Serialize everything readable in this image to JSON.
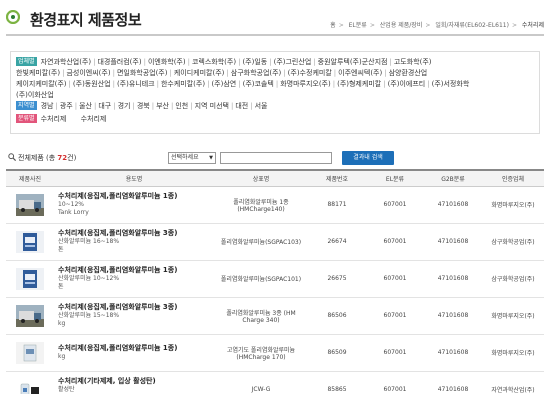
{
  "header": {
    "title": "환경표지 제품정보",
    "breadcrumb": [
      "홈",
      "EL분류",
      "산업용 제품/장비",
      "일회/자재류(EL602-EL611)",
      "수처리제"
    ]
  },
  "filters": {
    "company_tag": "업체별",
    "companies_line1": [
      "자연과학산업(주)",
      "대경플러컴(주)",
      "이엔화학(주)",
      "코렉스화학(주)",
      "(주)일동",
      "(주)그린산업",
      "중원알루텍(주)군산지점",
      "고도화학(주)"
    ],
    "companies_line2": [
      "한빛케미칼(주)",
      "금성이엔씨(주)",
      "면일화학공업(주)",
      "케이디케미칼(주)",
      "삼구화학공업(주)",
      "(주)수정케미칼",
      "이주엔씨텍(주)",
      "삼양환경산업"
    ],
    "companies_line3": [
      "케이지케미칼(주)",
      "(주)동원산업",
      "(주)유니테크",
      "한수케미칼(주)",
      "(주)삼연",
      "(주)코솔텍",
      "화명마루지오(주)",
      "(주)형제케미칼",
      "(주)이에프티",
      "(주)서정화학"
    ],
    "companies_line4": [
      "(주)이화산업"
    ],
    "region_tag": "지역별",
    "regions": [
      "경남",
      "광주",
      "울산",
      "대구",
      "경기",
      "경북",
      "부산",
      "인천",
      "지역 미선택",
      "대전",
      "서울"
    ],
    "category_tag": "분류별",
    "categories": [
      "수처리제",
      "수처리제"
    ]
  },
  "search": {
    "count_prefix": "전체제품 (총",
    "count": "72",
    "count_suffix": "건)",
    "select_value": "선택하세요",
    "input_value": "",
    "button_label": "결과내 검색"
  },
  "table": {
    "headers": [
      "제품사진",
      "용도명",
      "상표명",
      "제품번호",
      "EL분류",
      "G2B분류",
      "인증업체"
    ],
    "rows": [
      {
        "name": "수처리제(응집제,폴리염화알루미늄 1종)",
        "spec1": "10~12%",
        "spec2": "Tank Lorry",
        "brand1": "폴리염화알루미늄 1종",
        "brand2": "(HMCharge140)",
        "product_no": "88171",
        "el": "607001",
        "g2b": "47101608",
        "company": "화명마루지오(주)",
        "thumb": "truck"
      },
      {
        "name": "수처리제(응집제,폴리염화알루미늄 3종)",
        "spec1": "산화알루미늄 16~18%",
        "spec2": "톤",
        "brand1": "폴리염화알루미늄(SGPAC103)",
        "brand2": "",
        "product_no": "26674",
        "el": "607001",
        "g2b": "47101608",
        "company": "삼구화학공업(주)",
        "thumb": "bag"
      },
      {
        "name": "수처리제(응집제,폴리염화알루미늄 1종)",
        "spec1": "산화알루미늄 10~12%",
        "spec2": "톤",
        "brand1": "폴리염화알루미늄(SGPAC101)",
        "brand2": "",
        "product_no": "26675",
        "el": "607001",
        "g2b": "47101608",
        "company": "삼구화학공업(주)",
        "thumb": "bag"
      },
      {
        "name": "수처리제(응집제,폴리염화알루미늄 3종)",
        "spec1": "산화알루미늄 15~18%",
        "spec2": "kg",
        "brand1": "폴리염화알루미늄 3종 (HM",
        "brand2": "Charge 340)",
        "product_no": "86506",
        "el": "607001",
        "g2b": "47101608",
        "company": "화명마루지오(주)",
        "thumb": "truck"
      },
      {
        "name": "수처리제(응집제,폴리염화알루미늄 1종)",
        "spec1": "",
        "spec2": "kg",
        "brand1": "고염기도 폴리염화알루미늄",
        "brand2": "(HMCharge 170)",
        "product_no": "86509",
        "el": "607001",
        "g2b": "47101608",
        "company": "화명마루지오(주)",
        "thumb": "box"
      },
      {
        "name": "수처리제(기타제제, 입상 활성탄)",
        "spec1": "활성탄",
        "spec2": "kg",
        "brand1": "JCW-G",
        "brand2": "",
        "product_no": "85865",
        "el": "607001",
        "g2b": "47101608",
        "company": "자연과학산업(주)",
        "thumb": "bottle"
      }
    ]
  }
}
